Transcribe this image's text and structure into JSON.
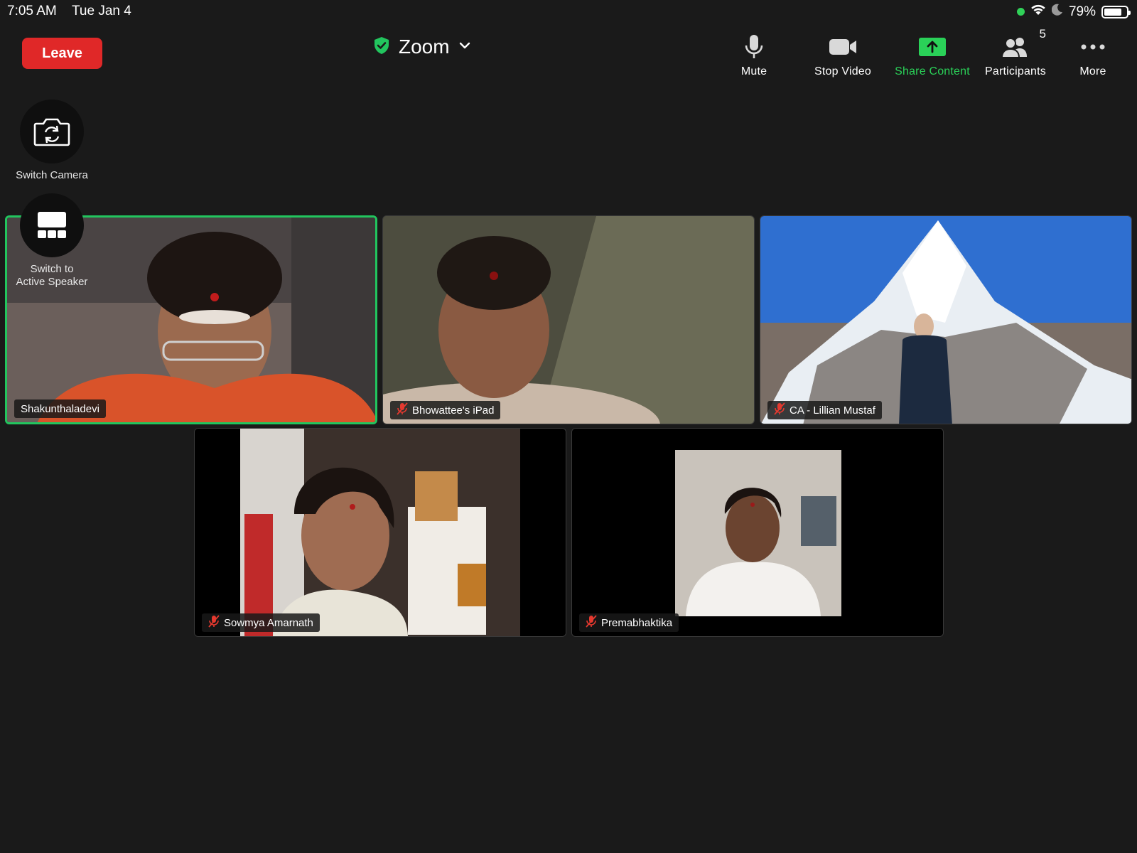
{
  "status_bar": {
    "time": "7:05 AM",
    "date": "Tue Jan 4",
    "battery": "79%",
    "battery_fraction": 0.79
  },
  "header": {
    "leave_label": "Leave",
    "meeting_title": "Zoom",
    "shield_color": "#22c55e"
  },
  "toolbar": {
    "mute_label": "Mute",
    "stop_video_label": "Stop Video",
    "share_label": "Share Content",
    "participants_label": "Participants",
    "participants_count": "5",
    "more_label": "More",
    "share_color": "#2ad158"
  },
  "side": {
    "switch_camera_label": "Switch Camera",
    "active_speaker_label_line1": "Switch to",
    "active_speaker_label_line2": "Active Speaker"
  },
  "participants": [
    {
      "name": "Shakunthaladevi",
      "muted": false,
      "active": true
    },
    {
      "name": "Bhowattee's iPad",
      "muted": true,
      "active": false
    },
    {
      "name": "CA - Lillian Mustaf",
      "muted": true,
      "active": false
    },
    {
      "name": "Sowmya Amarnath",
      "muted": true,
      "active": false
    },
    {
      "name": "Premabhaktika",
      "muted": true,
      "active": false
    }
  ],
  "icons": [
    "wifi-icon",
    "moon-icon",
    "battery-icon",
    "shield-check-icon",
    "chevron-down-icon",
    "microphone-icon",
    "video-camera-icon",
    "share-arrow-icon",
    "participants-icon",
    "more-dots-icon",
    "switch-camera-icon",
    "gallery-layout-icon",
    "muted-mic-icon"
  ],
  "colors": {
    "background": "#1a1a1a",
    "leave": "#e02828",
    "active_border": "#22c55e",
    "muted_icon": "#e5392f"
  }
}
